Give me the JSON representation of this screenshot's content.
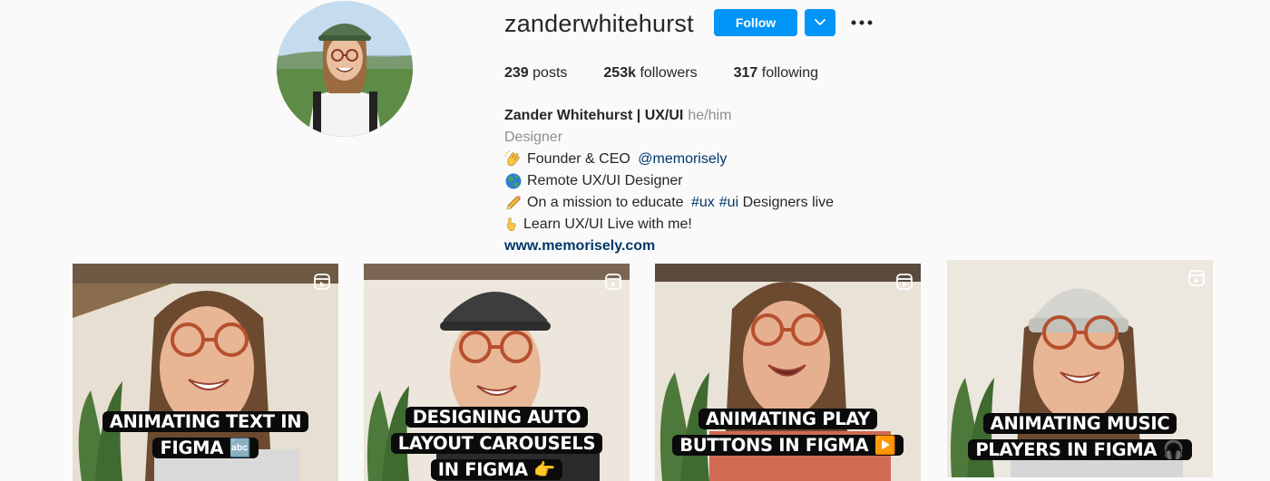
{
  "profile": {
    "username": "zanderwhitehurst",
    "follow_label": "Follow",
    "stats": {
      "posts_count": "239",
      "posts_label": "posts",
      "followers_count": "253k",
      "followers_label": "followers",
      "following_count": "317",
      "following_label": "following"
    },
    "bio": {
      "full_name": "Zander Whitehurst | UX/UI",
      "pronouns": "he/him",
      "category": "Designer",
      "line1_text": "Founder & CEO ",
      "line1_mention": "@memorisely",
      "line2_text": "Remote UX/UI Designer",
      "line3_text": "On a mission to educate ",
      "line3_tag1": "#ux",
      "line3_tag2": "#ui",
      "line3_suffix": " Designers live",
      "line4_text": "Learn UX/UI Live with me!",
      "website": "www.memorisely.com"
    }
  },
  "icons": {
    "line1": "clapping-hands-icon",
    "line2": "globe-icon",
    "line3": "pencil-icon",
    "line4": "pointing-down-icon",
    "reel": "reel-icon",
    "more": "more-horizontal-icon",
    "dropdown": "chevron-down-icon"
  },
  "colors": {
    "accent": "#0095f6",
    "link": "#00376b",
    "muted": "#8e8e8e"
  },
  "posts": [
    {
      "caption_line1": "ANIMATING TEXT IN",
      "caption_line2": "FIGMA 🔤",
      "caption_line3": ""
    },
    {
      "caption_line1": "DESIGNING AUTO",
      "caption_line2": "LAYOUT CAROUSELS",
      "caption_line3": "IN FIGMA 👉"
    },
    {
      "caption_line1": "ANIMATING PLAY",
      "caption_line2": "BUTTONS IN FIGMA ▶️",
      "caption_line3": ""
    },
    {
      "caption_line1": "ANIMATING MUSIC",
      "caption_line2": "PLAYERS IN FIGMA 🎧",
      "caption_line3": ""
    }
  ]
}
